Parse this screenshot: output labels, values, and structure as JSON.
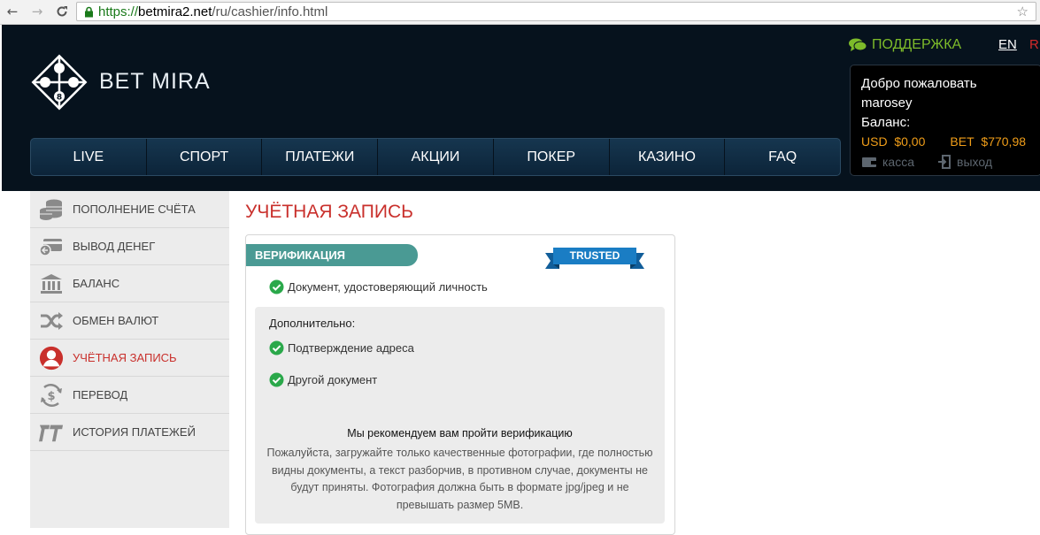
{
  "browser": {
    "url_protocol": "https://",
    "url_host": "betmira2.net",
    "url_path": "/ru/cashier/info.html",
    "back_icon": "arrow-left-icon",
    "forward_icon": "arrow-right-icon",
    "reload_icon": "reload-icon",
    "bookmark_icon": "star-icon"
  },
  "header": {
    "logo_text": "BET MIRA",
    "support_label": "ПОДДЕРЖКА",
    "lang_en": "EN",
    "lang_ru": "RU",
    "colors": {
      "header_bg": "#06121d",
      "support": "#7dbb2a",
      "accent_red": "#c9302c",
      "balance": "#ef9d19"
    }
  },
  "user": {
    "welcome": "Добро пожаловать",
    "username": "marosey",
    "balance_label": "Баланс:",
    "usd_label": "USD",
    "usd_value": "$0,00",
    "bet_label": "BET",
    "bet_value": "$770,98",
    "cashier_label": "касса",
    "logout_label": "выход"
  },
  "nav": {
    "items": [
      {
        "label": "LIVE"
      },
      {
        "label": "СПОРТ"
      },
      {
        "label": "ПЛАТЕЖИ"
      },
      {
        "label": "АКЦИИ"
      },
      {
        "label": "ПОКЕР"
      },
      {
        "label": "КАЗИНО"
      },
      {
        "label": "FAQ"
      }
    ]
  },
  "sidebar": {
    "items": [
      {
        "label": "ПОПОЛНЕНИЕ СЧЁТА",
        "icon": "coins-icon"
      },
      {
        "label": "ВЫВОД ДЕНЕГ",
        "icon": "card-icon"
      },
      {
        "label": "БАЛАНС",
        "icon": "bank-icon"
      },
      {
        "label": "ОБМЕН ВАЛЮТ",
        "icon": "shuffle-icon"
      },
      {
        "label": "УЧЁТНАЯ ЗАПИСЬ",
        "icon": "user-icon",
        "active": true
      },
      {
        "label": "ПЕРЕВОД",
        "icon": "dollar-transfer-icon"
      },
      {
        "label": "ИСТОРИЯ ПЛАТЕЖЕЙ",
        "icon": "history-icon"
      }
    ]
  },
  "content": {
    "title": "УЧЁТНАЯ ЗАПИСЬ",
    "verification_tab": "ВЕРИФИКАЦИЯ",
    "badge": "TRUSTED",
    "identity_doc": "Документ, удостоверяющий личность",
    "additional_title": "Дополнительно:",
    "address_confirm": "Подтверждение адреса",
    "other_doc": "Другой документ",
    "recommend_title": "Мы рекомендуем вам пройти верификацию",
    "recommend_body": "Пожалуйста, загружайте только качественные фотографии, где полностью видны документы, а текст разборчив, в противном случае, документы не будут приняты. Фотография должна быть в формате jpg/jpeg и не превышать размер 5MB."
  }
}
